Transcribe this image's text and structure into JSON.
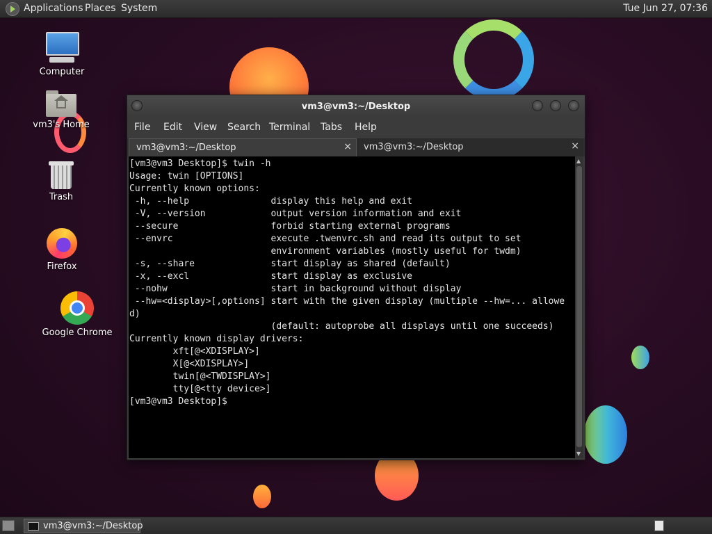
{
  "top_panel": {
    "menus": [
      "Applications",
      "Places",
      "System"
    ],
    "clock": "Tue Jun 27, 07:36"
  },
  "desktop_icons": [
    {
      "label": "Computer",
      "icon": "computer-icon"
    },
    {
      "label": "vm3's Home",
      "icon": "home-folder-icon"
    },
    {
      "label": "Trash",
      "icon": "trash-icon"
    },
    {
      "label": "Firefox",
      "icon": "firefox-icon"
    },
    {
      "label": "Google Chrome",
      "icon": "chrome-icon"
    }
  ],
  "terminal": {
    "title": "vm3@vm3:~/Desktop",
    "menu": [
      "File",
      "Edit",
      "View",
      "Search",
      "Terminal",
      "Tabs",
      "Help"
    ],
    "tabs": [
      {
        "label": "vm3@vm3:~/Desktop",
        "active": true
      },
      {
        "label": "vm3@vm3:~/Desktop",
        "active": false
      }
    ],
    "close_glyph": "×",
    "output": "[vm3@vm3 Desktop]$ twin -h\nUsage: twin [OPTIONS]\nCurrently known options:\n -h, --help               display this help and exit\n -V, --version            output version information and exit\n --secure                 forbid starting external programs\n --envrc                  execute .twenvrc.sh and read its output to set\n                          environment variables (mostly useful for twdm)\n -s, --share              start display as shared (default)\n -x, --excl               start display as exclusive\n --nohw                   start in background without display\n --hw=<display>[,options] start with the given display (multiple --hw=... allowe\nd)\n                          (default: autoprobe all displays until one succeeds)\nCurrently known display drivers:\n        xft[@<XDISPLAY>]\n        X[@<XDISPLAY>]\n        twin[@<TWDISPLAY>]\n        tty[@<tty device>]\n[vm3@vm3 Desktop]$"
  },
  "taskbar": {
    "tasks": [
      {
        "label": "vm3@vm3:~/Desktop",
        "icon": "terminal-icon"
      }
    ]
  }
}
